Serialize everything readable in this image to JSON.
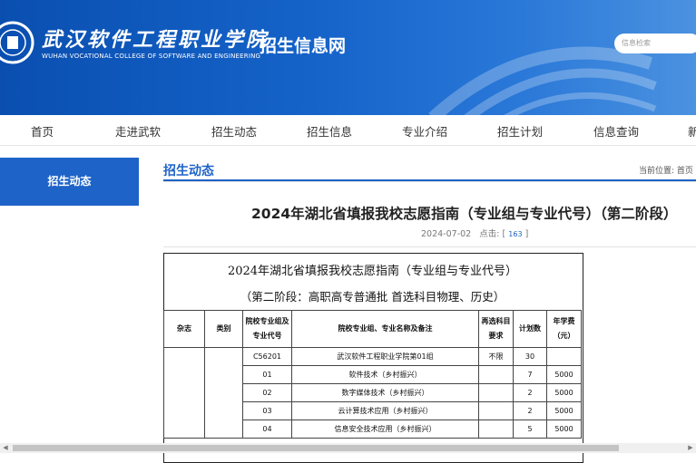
{
  "header": {
    "school_name_cn": "武汉软件工程职业学院",
    "school_name_en": "WUHAN VOCATIONAL COLLEGE OF SOFTWARE AND ENGINEERING",
    "site_title": "招生信息网",
    "search_placeholder": "信息检索"
  },
  "nav": [
    "首页",
    "走进武软",
    "招生动态",
    "招生信息",
    "专业介绍",
    "招生计划",
    "信息查询",
    "新"
  ],
  "sidebar": {
    "active_label": "招生动态"
  },
  "section": {
    "title": "招生动态",
    "breadcrumb": "当前位置: 首页 >"
  },
  "article": {
    "title": "2024年湖北省填报我校志愿指南（专业组与专业代号）（第二阶段）",
    "date": "2024-07-02",
    "clicks_label": "点击:",
    "clicks_open": "[",
    "clicks": "163",
    "clicks_close": "]"
  },
  "document": {
    "heading1": "2024年湖北省填报我校志愿指南（专业组与专业代号）",
    "heading2": "（第二阶段：高职高专普通批  首选科目物理、历史）",
    "columns": [
      "杂志",
      "类别",
      "院校专业组及专业代号",
      "院校专业组、专业名称及备注",
      "再选科目要求",
      "计划数",
      "年学费（元）"
    ],
    "rows": [
      {
        "code": "C56201",
        "name": "武汉软件工程职业学院第01组",
        "req": "不限",
        "plan": "30",
        "fee": ""
      },
      {
        "code": "01",
        "name": "软件技术（乡村振兴）",
        "req": "",
        "plan": "7",
        "fee": "5000"
      },
      {
        "code": "02",
        "name": "数字媒体技术（乡村振兴）",
        "req": "",
        "plan": "2",
        "fee": "5000"
      },
      {
        "code": "03",
        "name": "云计算技术应用（乡村振兴）",
        "req": "",
        "plan": "2",
        "fee": "5000"
      },
      {
        "code": "04",
        "name": "信息安全技术应用（乡村振兴）",
        "req": "",
        "plan": "5",
        "fee": "5000"
      }
    ]
  },
  "colors": {
    "brand_blue": "#1e63c8",
    "header_blue": "#0a4fb0"
  }
}
